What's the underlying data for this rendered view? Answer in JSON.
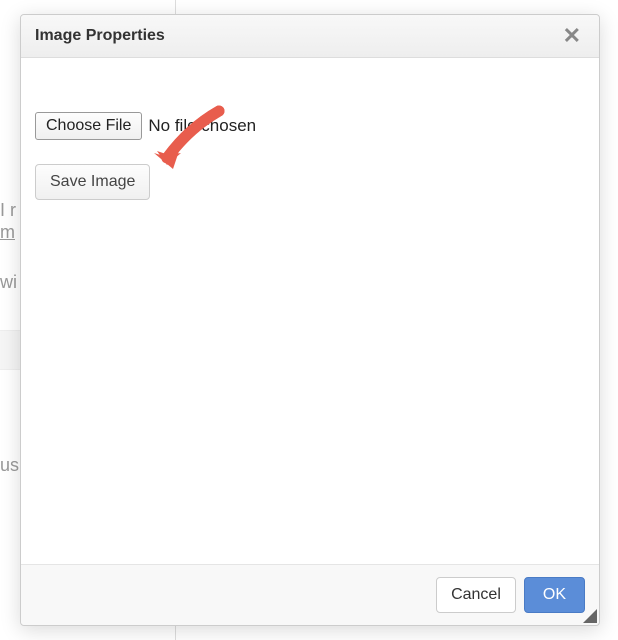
{
  "dialog": {
    "title": "Image Properties",
    "choose_file_label": "Choose File",
    "no_file_text": "No file chosen",
    "save_image_label": "Save Image",
    "cancel_label": "Cancel",
    "ok_label": "OK"
  },
  "background": {
    "text1": "I r",
    "text1a": "m",
    "text2": "wi",
    "text3": "us"
  }
}
